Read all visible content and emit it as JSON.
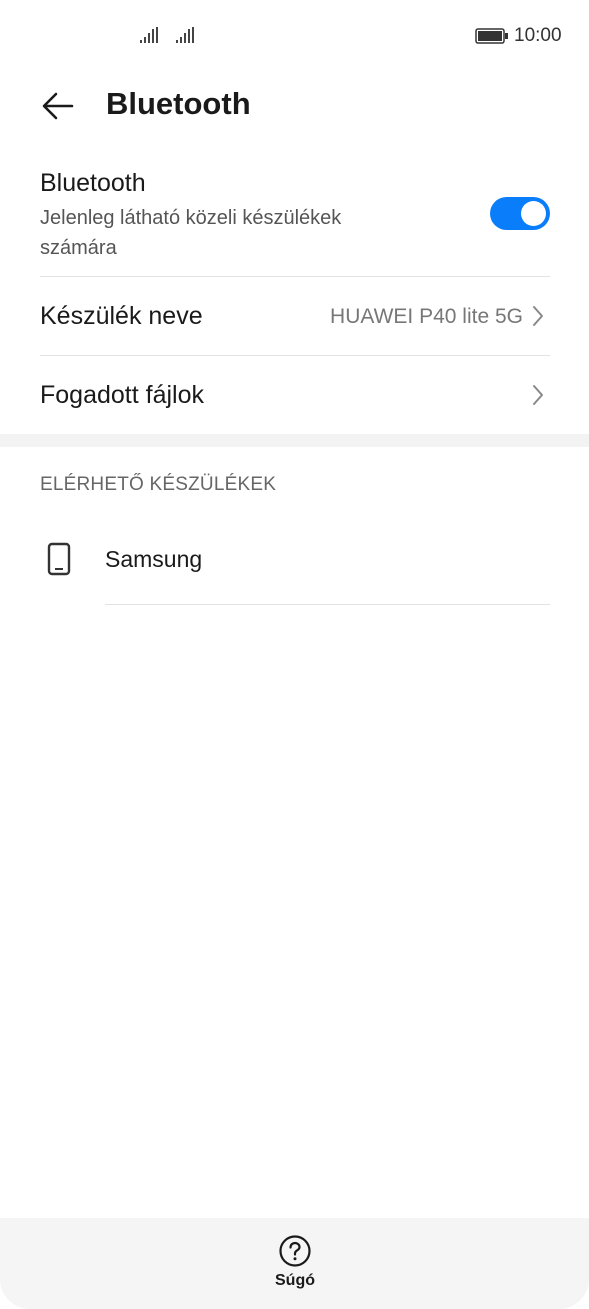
{
  "status_bar": {
    "time": "10:00",
    "icons": [
      "signal-icon",
      "signal-icon",
      "battery-icon"
    ]
  },
  "header": {
    "title": "Bluetooth",
    "back_icon": "back-arrow-icon"
  },
  "bluetooth": {
    "title": "Bluetooth",
    "subtitle": "Jelenleg látható közeli készülékek számára",
    "enabled": true,
    "accent_color": "#0a7dfa"
  },
  "settings": {
    "device_name_label": "Készülék neve",
    "device_name_value": "HUAWEI P40 lite 5G",
    "received_files_label": "Fogadott fájlok"
  },
  "available": {
    "section_title": "ELÉRHETŐ KÉSZÜLÉKEK",
    "devices": [
      {
        "name": "Samsung",
        "icon": "phone-icon"
      }
    ]
  },
  "bottom_bar": {
    "help_label": "Súgó",
    "help_icon": "help-icon"
  }
}
